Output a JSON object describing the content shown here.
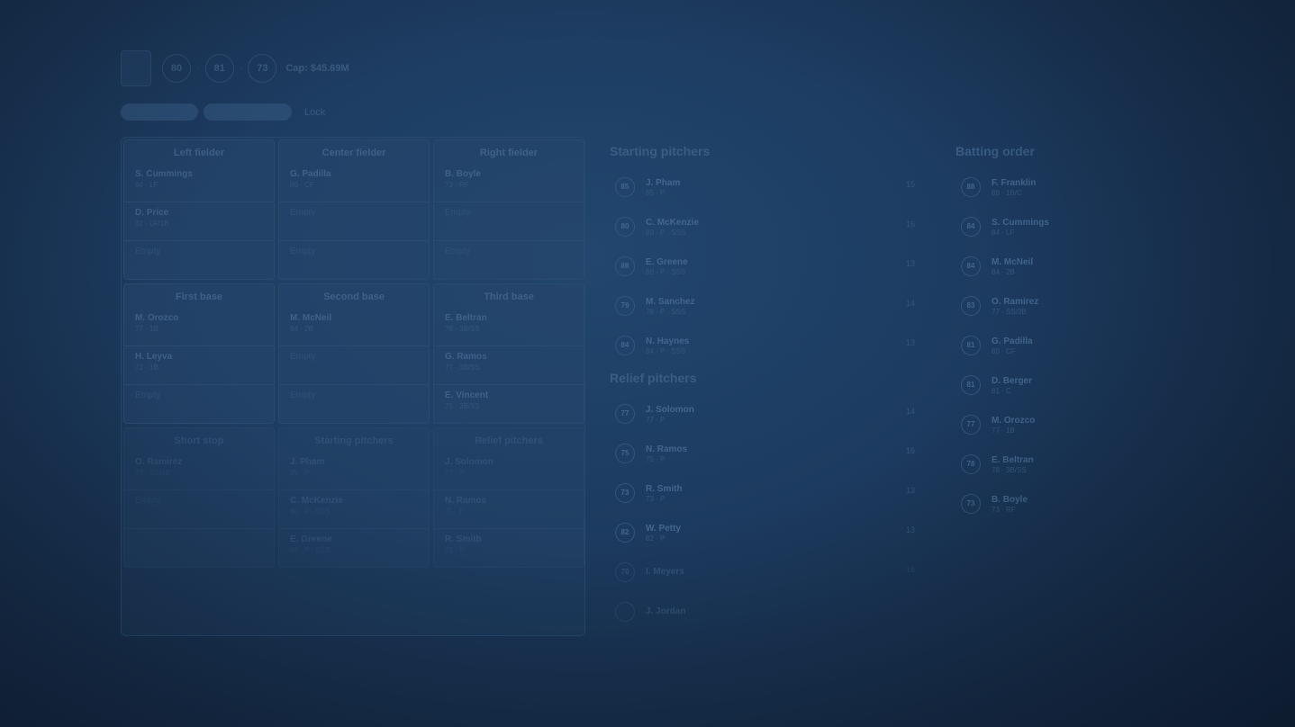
{
  "header": {
    "title": "",
    "subtitle": ""
  },
  "team": {
    "logo_text": "",
    "ratings": [
      "80",
      "81",
      "73"
    ],
    "cap": "Cap: $45.69M"
  },
  "toolbar": {
    "btn1": "",
    "btn2": "",
    "link": "Lock"
  },
  "positions": [
    {
      "title": "Left fielder",
      "slots": [
        {
          "name": "S. Cummings",
          "meta": "84 · LF"
        },
        {
          "name": "D. Price",
          "meta": "82 · LF/1B"
        },
        {
          "name": "",
          "meta": "",
          "empty": "Empty"
        }
      ]
    },
    {
      "title": "Center fielder",
      "slots": [
        {
          "name": "G. Padilla",
          "meta": "80 · CF"
        },
        {
          "name": "",
          "meta": "",
          "empty": "Empty"
        },
        {
          "name": "",
          "meta": "",
          "empty": "Empty"
        }
      ]
    },
    {
      "title": "Right fielder",
      "slots": [
        {
          "name": "B. Boyle",
          "meta": "73 · RF"
        },
        {
          "name": "",
          "meta": "",
          "empty": "Empty"
        },
        {
          "name": "",
          "meta": "",
          "empty": "Empty"
        }
      ]
    },
    {
      "title": "First base",
      "slots": [
        {
          "name": "M. Orozco",
          "meta": "77 · 1B"
        },
        {
          "name": "H. Leyva",
          "meta": "72 · 1B"
        },
        {
          "name": "",
          "meta": "",
          "empty": "Empty"
        }
      ]
    },
    {
      "title": "Second base",
      "slots": [
        {
          "name": "M. McNeil",
          "meta": "84 · 2B"
        },
        {
          "name": "",
          "meta": "",
          "empty": "Empty"
        },
        {
          "name": "",
          "meta": "",
          "empty": "Empty"
        }
      ]
    },
    {
      "title": "Third base",
      "slots": [
        {
          "name": "E. Beltran",
          "meta": "78 · 3B/SS"
        },
        {
          "name": "G. Ramos",
          "meta": "77 · 3B/SS"
        },
        {
          "name": "E. Vincent",
          "meta": "71 · 3B/SS"
        }
      ]
    },
    {
      "title": "Short stop",
      "slots": [
        {
          "name": "O. Ramirez",
          "meta": "77 · SS/3B"
        },
        {
          "name": "",
          "meta": "",
          "empty": "Empty"
        },
        {
          "name": "",
          "meta": "",
          "empty": ""
        }
      ]
    },
    {
      "title": "Starting pitchers",
      "slots": [
        {
          "name": "J. Pham",
          "meta": "85 · P"
        },
        {
          "name": "C. McKenzie",
          "meta": "80 · P · SSS"
        },
        {
          "name": "E. Greene",
          "meta": "88 · P · SSS"
        },
        {
          "name": "M. Sanchez",
          "meta": ""
        }
      ]
    },
    {
      "title": "Relief pitchers",
      "slots": [
        {
          "name": "J. Solomon",
          "meta": "77 · P"
        },
        {
          "name": "N. Ramos",
          "meta": "75 · P"
        },
        {
          "name": "R. Smith",
          "meta": "73 · P"
        },
        {
          "name": "W. Petty",
          "meta": ""
        }
      ]
    }
  ],
  "starting_pitchers": {
    "title": "Starting pitchers",
    "rows": [
      {
        "rating": "85",
        "name": "J. Pham",
        "meta": "85 · P",
        "num": "15"
      },
      {
        "rating": "80",
        "name": "C. McKenzie",
        "meta": "80 · P · SSS",
        "num": "16"
      },
      {
        "rating": "88",
        "name": "E. Greene",
        "meta": "88 · P · SSS",
        "num": "13"
      },
      {
        "rating": "79",
        "name": "M. Sanchez",
        "meta": "78 · P · SSS",
        "num": "14"
      },
      {
        "rating": "84",
        "name": "N. Haynes",
        "meta": "84 · P · SSS",
        "num": "13"
      }
    ]
  },
  "relief_pitchers": {
    "title": "Relief pitchers",
    "rows": [
      {
        "rating": "77",
        "name": "J. Solomon",
        "meta": "77 · P",
        "num": "14"
      },
      {
        "rating": "75",
        "name": "N. Ramos",
        "meta": "75 · P",
        "num": "16"
      },
      {
        "rating": "73",
        "name": "R. Smith",
        "meta": "73 · P",
        "num": "13"
      },
      {
        "rating": "82",
        "name": "W. Petty",
        "meta": "82 · P",
        "num": "13"
      },
      {
        "rating": "70",
        "name": "I. Meyers",
        "meta": "",
        "num": "16"
      },
      {
        "rating": "",
        "name": "J. Jordan",
        "meta": "",
        "num": ""
      }
    ]
  },
  "batting_order": {
    "title": "Batting order",
    "rows": [
      {
        "rating": "88",
        "name": "F. Franklin",
        "meta": "88 · 1B/C"
      },
      {
        "rating": "84",
        "name": "S. Cummings",
        "meta": "84 · LF"
      },
      {
        "rating": "84",
        "name": "M. McNeil",
        "meta": "84 · 2B"
      },
      {
        "rating": "83",
        "name": "O. Ramirez",
        "meta": "77 · SS/3B"
      },
      {
        "rating": "81",
        "name": "G. Padilla",
        "meta": "80 · CF"
      },
      {
        "rating": "81",
        "name": "D. Berger",
        "meta": "81 · C"
      },
      {
        "rating": "77",
        "name": "M. Orozco",
        "meta": "77 · 1B"
      },
      {
        "rating": "78",
        "name": "E. Beltran",
        "meta": "78 · 3B/SS"
      },
      {
        "rating": "73",
        "name": "B. Boyle",
        "meta": "73 · RF"
      }
    ]
  }
}
